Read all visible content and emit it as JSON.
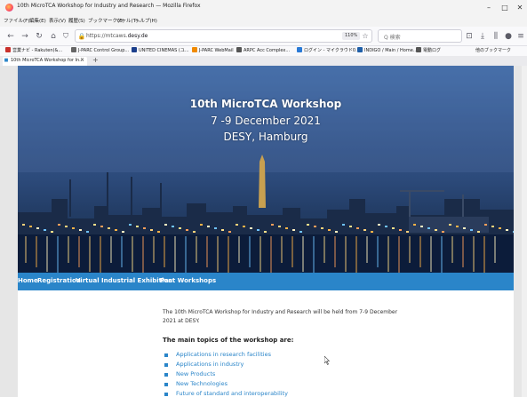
{
  "window": {
    "title": "10th MicroTCA Workshop for Industry and Research — Mozilla Firefox"
  },
  "menu": [
    "ファイル(F)",
    "編集(E)",
    "表示(V)",
    "履歴(S)",
    "ブックマーク(B)",
    "ツール(T)",
    "ヘルプ(H)"
  ],
  "toolbar": {
    "url_prefix": "https://mtcaws.",
    "url_domain": "desy.de",
    "zoom": "110%",
    "search_placeholder": "Q 検索"
  },
  "bookmarks": [
    {
      "label": "営業ナビ - Rakuten(&...",
      "color": "#c9302c"
    },
    {
      "label": "J-PARC Control Group...",
      "color": "#666666"
    },
    {
      "label": "UNITED CINEMAS (ユ...",
      "color": "#1c3f8c"
    },
    {
      "label": "J-PARC WebMail",
      "color": "#f08a00"
    },
    {
      "label": "ARPC Acc Complex...",
      "color": "#555555"
    },
    {
      "label": "J-PARC Acc Complex...",
      "color": "#666666"
    },
    {
      "label": "ログイン - マイクラウド0...",
      "color": "#2a7ad6"
    },
    {
      "label": "INDIGO / Main / Home...",
      "color": "#1f5fa8"
    },
    {
      "label": "電動ログ",
      "color": "#555555"
    }
  ],
  "bookmarks_other": "他のブックマーク",
  "tab": {
    "label": "10th MicroTCA Workshop for In..."
  },
  "hero": {
    "line1": "10th MicroTCA Workshop",
    "line2": "7 -9 December 2021",
    "line3": "DESY, Hamburg"
  },
  "nav": [
    "Home",
    "Registration",
    "Virtual Industrial Exhibition",
    "Past Workshops"
  ],
  "content": {
    "intro": "The 10th MicroTCA Workshop for Industry and Research will be held from 7-9 December 2021 at DESY.",
    "topics_heading": "The main topics of the workshop are:",
    "topics": [
      "Applications in research facilities",
      "Applications in industry",
      "New Products",
      "New Technologies",
      "Future of standard and interoperability"
    ]
  },
  "colors": {
    "accent": "#2a85c9",
    "hero_sky": "#34578d"
  }
}
